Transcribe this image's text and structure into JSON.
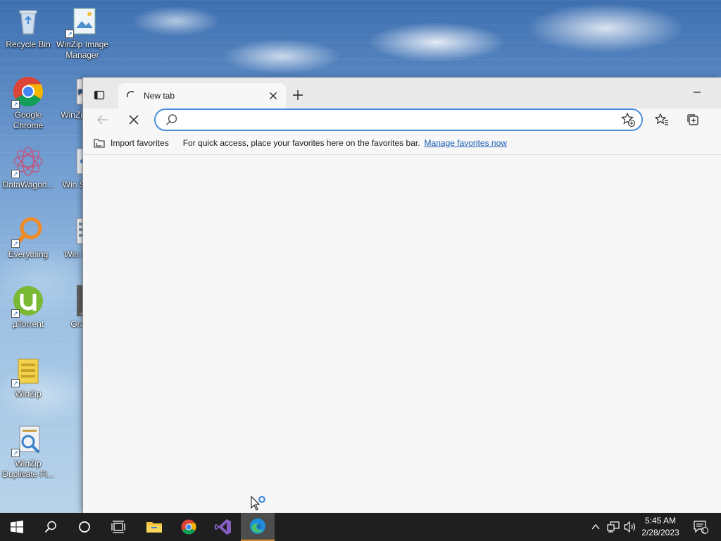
{
  "desktop": {
    "icons": [
      {
        "label": "Recycle Bin",
        "icon": "recycle-bin-icon"
      },
      {
        "label": "WinZip Image Manager",
        "icon": "winzip-image-manager-icon"
      },
      {
        "label": "Google Chrome",
        "icon": "chrome-icon"
      },
      {
        "label": "WinZip Exp",
        "icon": "winzip-pdf-express-icon"
      },
      {
        "label": "DataWagon...",
        "icon": "datawagon-icon"
      },
      {
        "label": "Win SafeS",
        "icon": "winzip-safeshare-icon"
      },
      {
        "label": "Everything",
        "icon": "everything-icon"
      },
      {
        "label": "Win Secu",
        "icon": "winzip-secure-icon"
      },
      {
        "label": "µTorrent",
        "icon": "utorrent-icon"
      },
      {
        "label": "Grann",
        "icon": "granny-icon"
      },
      {
        "label": "WinZip",
        "icon": "winzip-icon"
      },
      {
        "label": "WinZip Duplicate Fi...",
        "icon": "winzip-duplicate-finder-icon"
      }
    ]
  },
  "browser": {
    "tab": {
      "title": "New tab"
    },
    "address": {
      "value": "",
      "placeholder": ""
    },
    "favbar": {
      "import_label": "Import favorites",
      "message": "For quick access, place your favorites here on the favorites bar.",
      "manage_link": "Manage favorites now"
    }
  },
  "taskbar": {
    "items": [
      "start",
      "search",
      "cortana",
      "task-view",
      "file-explorer",
      "chrome",
      "visual-studio",
      "edge"
    ],
    "active_item": "edge",
    "clock": {
      "time": "5:45 AM",
      "date": "2/28/2023"
    },
    "notification_count": "1"
  },
  "colors": {
    "accent": "#4a90d9",
    "link": "#1a5fb4",
    "taskbar": "#1f1f1f",
    "active_underline": "#d98a2b"
  }
}
